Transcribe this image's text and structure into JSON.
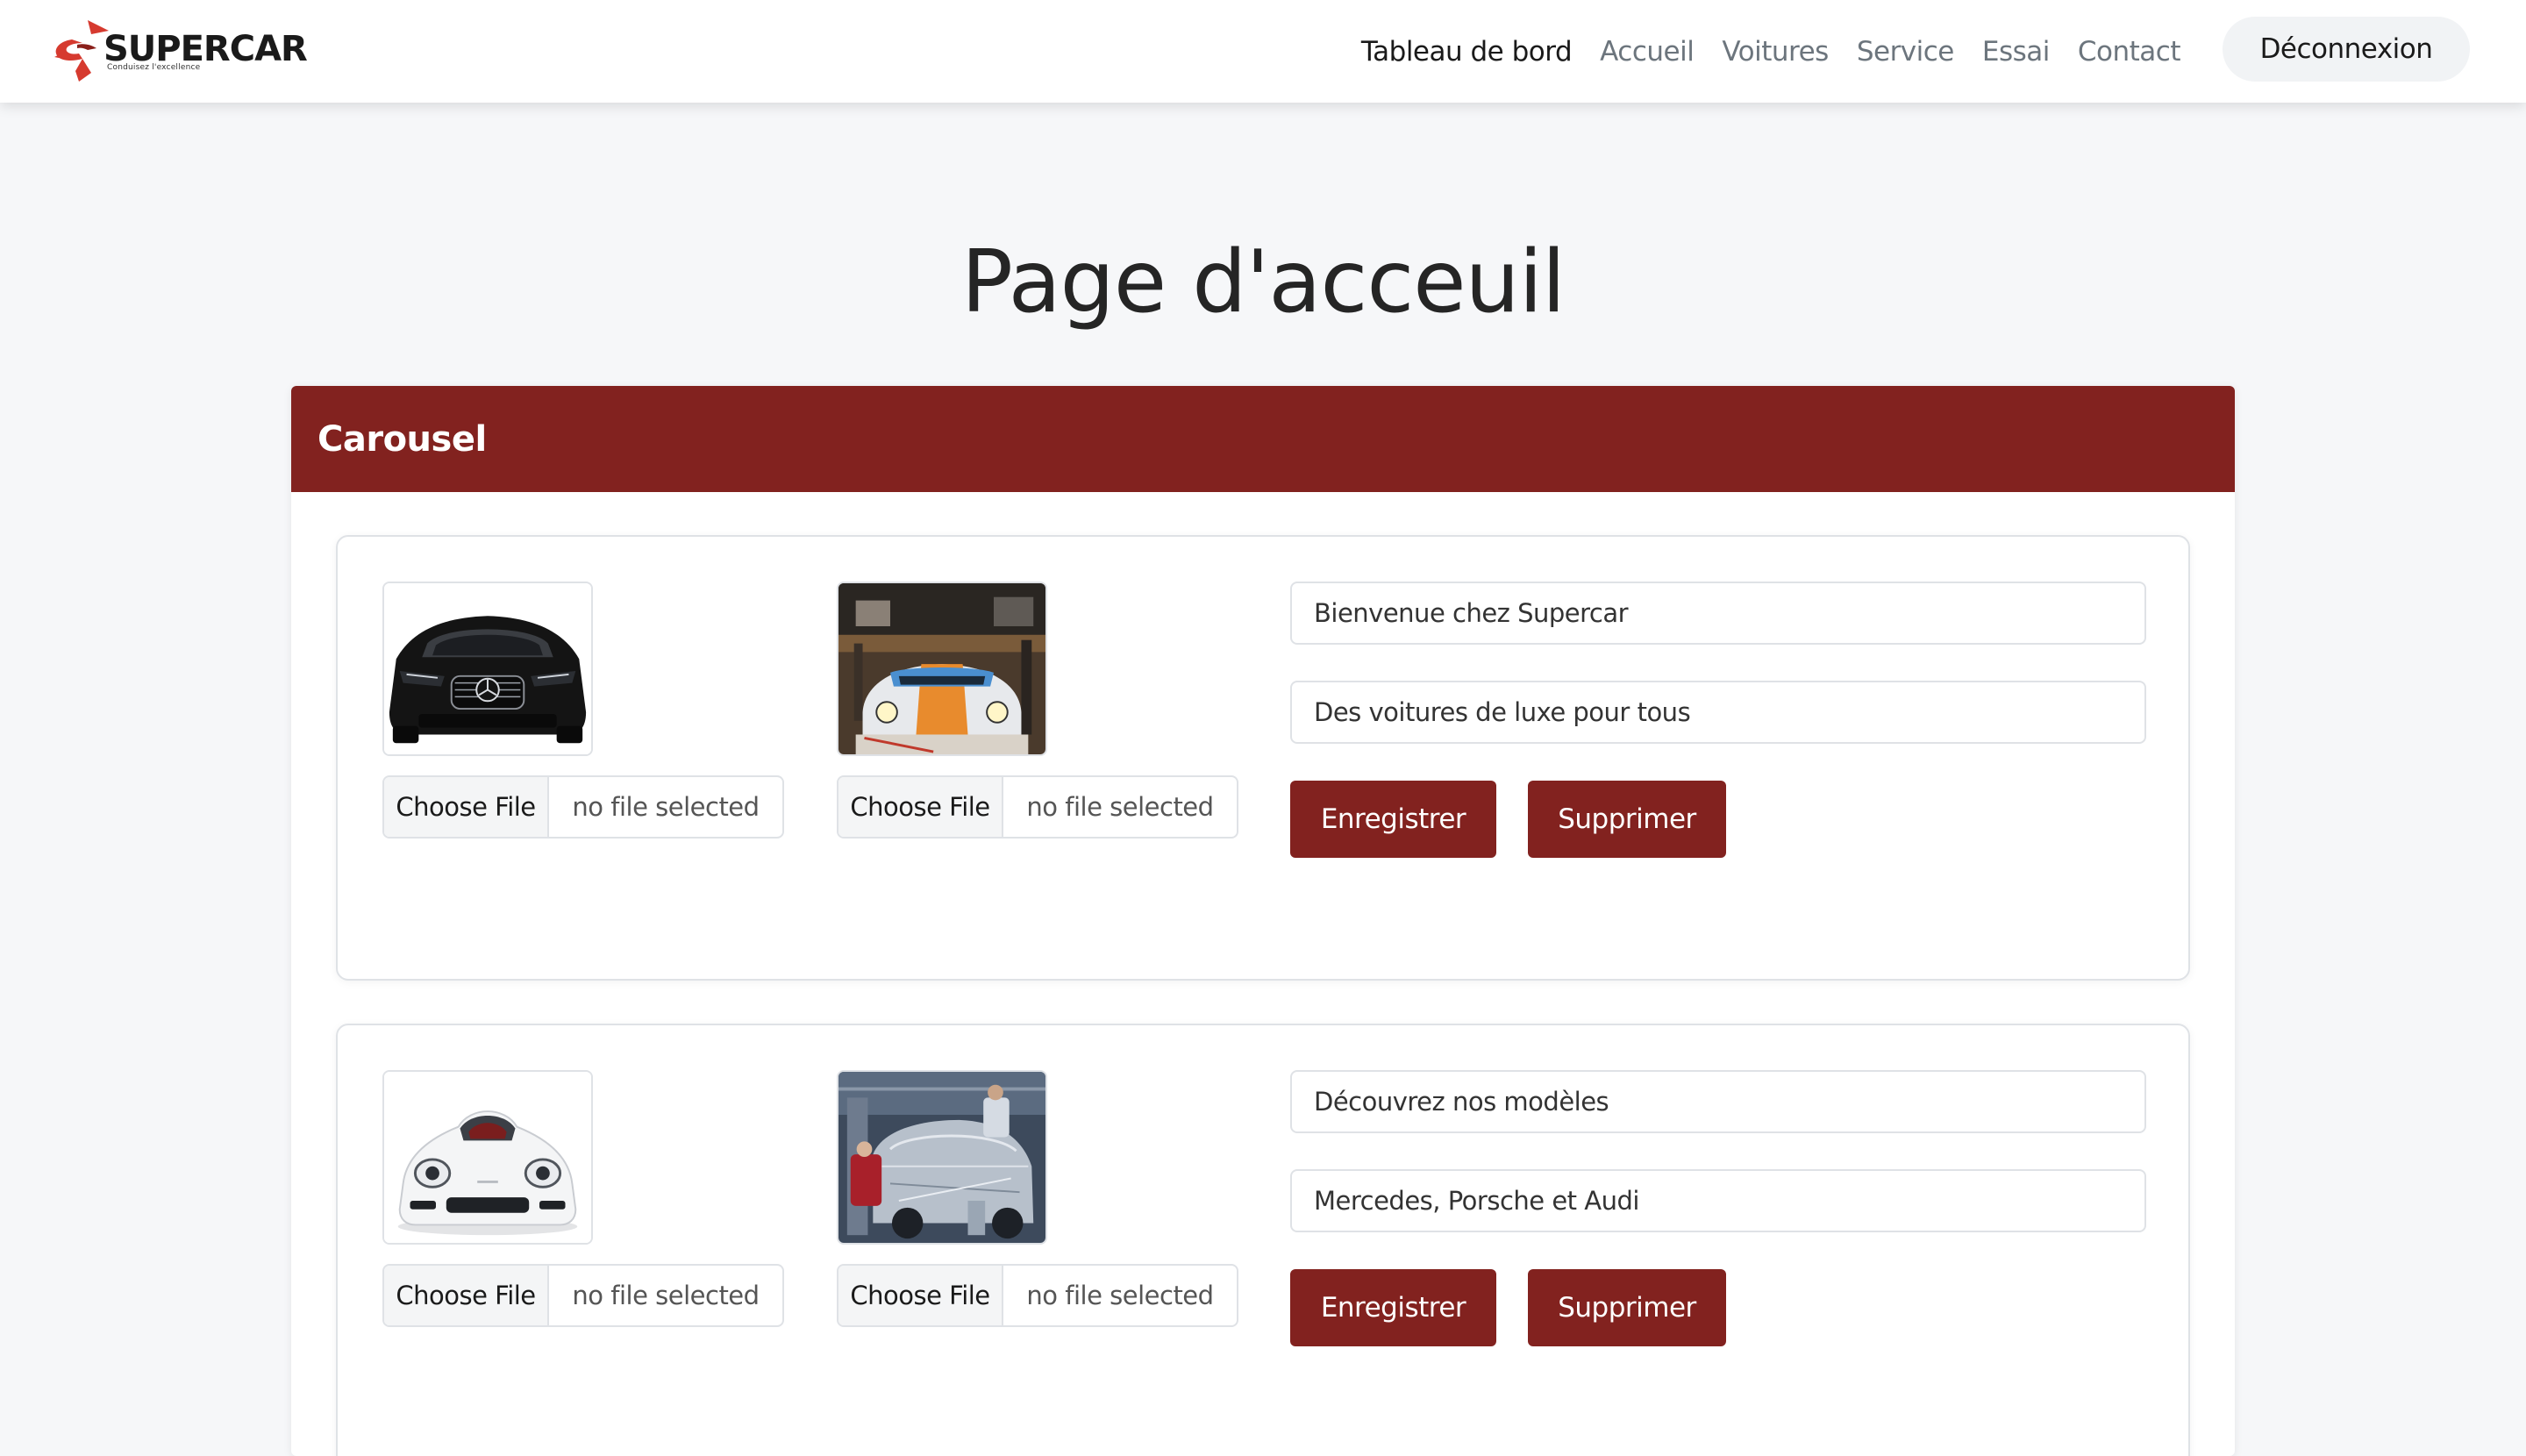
{
  "brand": {
    "name": "SUPERCAR",
    "tagline": "Conduisez l'excellence",
    "accent_color": "#d63a2f"
  },
  "nav": {
    "links": [
      {
        "label": "Tableau de bord",
        "active": true
      },
      {
        "label": "Accueil",
        "active": false
      },
      {
        "label": "Voitures",
        "active": false
      },
      {
        "label": "Service",
        "active": false
      },
      {
        "label": "Essai",
        "active": false
      },
      {
        "label": "Contact",
        "active": false
      }
    ],
    "logout_label": "Déconnexion"
  },
  "page": {
    "title": "Page d'acceuil"
  },
  "carousel": {
    "header": "Carousel",
    "header_color": "#82221f",
    "slides": [
      {
        "images": [
          {
            "icon": "black-mercedes-front-image"
          },
          {
            "icon": "race-car-garage-image"
          }
        ],
        "file_inputs": [
          {
            "button": "Choose File",
            "status": "no file selected"
          },
          {
            "button": "Choose File",
            "status": "no file selected"
          }
        ],
        "title": "Bienvenue chez Supercar",
        "subtitle": "Des voitures de luxe pour tous",
        "save_label": "Enregistrer",
        "delete_label": "Supprimer"
      },
      {
        "images": [
          {
            "icon": "white-porsche-front-image"
          },
          {
            "icon": "car-workshop-image"
          }
        ],
        "file_inputs": [
          {
            "button": "Choose File",
            "status": "no file selected"
          },
          {
            "button": "Choose File",
            "status": "no file selected"
          }
        ],
        "title": "Découvrez nos modèles",
        "subtitle": "Mercedes, Porsche et Audi",
        "save_label": "Enregistrer",
        "delete_label": "Supprimer"
      }
    ]
  }
}
